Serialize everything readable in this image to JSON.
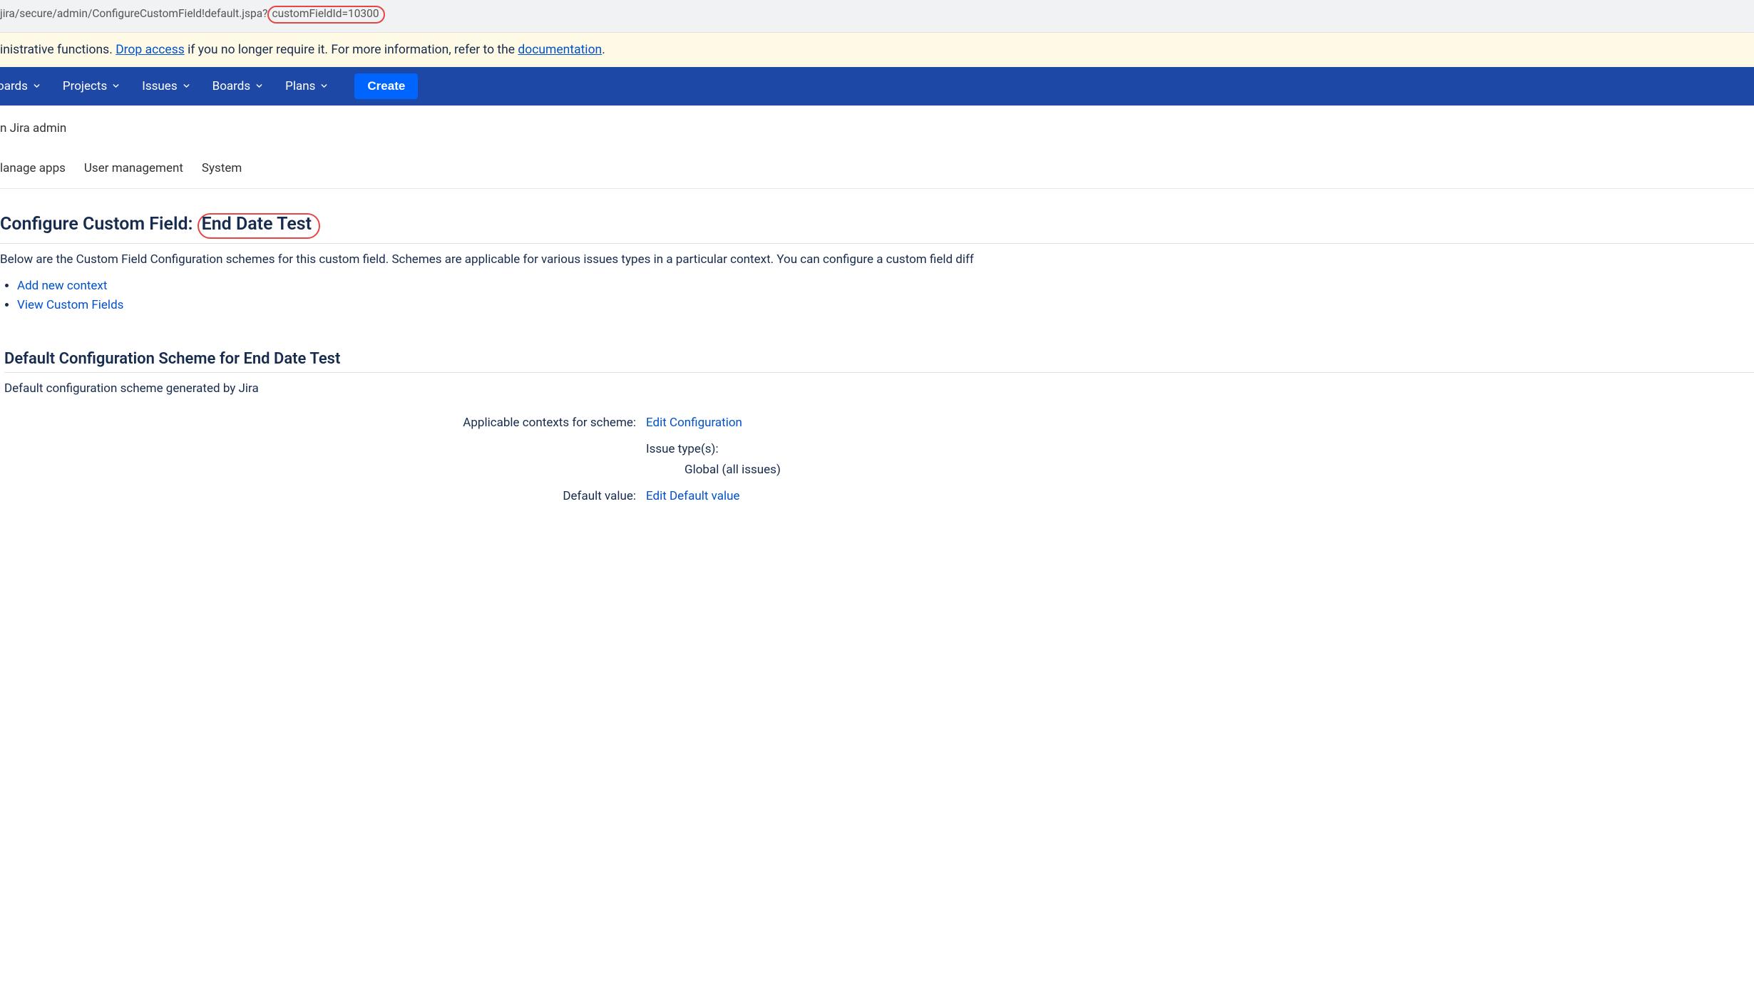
{
  "url": {
    "prefix": "jira/secure/admin/ConfigureCustomField!default.jspa?",
    "highlighted": "customFieldId=10300"
  },
  "banner": {
    "prefix_text": "inistrative functions. ",
    "drop_access": "Drop access",
    "middle_text": " if you no longer require it. For more information, refer to the ",
    "documentation": "documentation",
    "suffix_text": "."
  },
  "nav": {
    "dashboards": "oards",
    "projects": "Projects",
    "issues": "Issues",
    "boards": "Boards",
    "plans": "Plans",
    "create": "Create"
  },
  "breadcrumb": "n Jira admin",
  "tabs": {
    "manage_apps": "lanage apps",
    "user_management": "User management",
    "system": "System"
  },
  "heading": {
    "prefix": "Configure Custom Field: ",
    "field_name": "End Date Test"
  },
  "intro_text": "Below are the Custom Field Configuration schemes for this custom field. Schemes are applicable for various issues types in a particular context. You can configure a custom field diff",
  "actions": {
    "add_context": "Add new context",
    "view_fields": "View Custom Fields"
  },
  "scheme": {
    "title": "Default Configuration Scheme for End Date Test",
    "description": "Default configuration scheme generated by Jira",
    "rows": {
      "contexts_label": "Applicable contexts for scheme:",
      "edit_config": "Edit Configuration",
      "issue_types_label": "Issue type(s):",
      "issue_types_value": "Global (all issues)",
      "default_value_label": "Default value:",
      "edit_default": "Edit Default value"
    }
  }
}
